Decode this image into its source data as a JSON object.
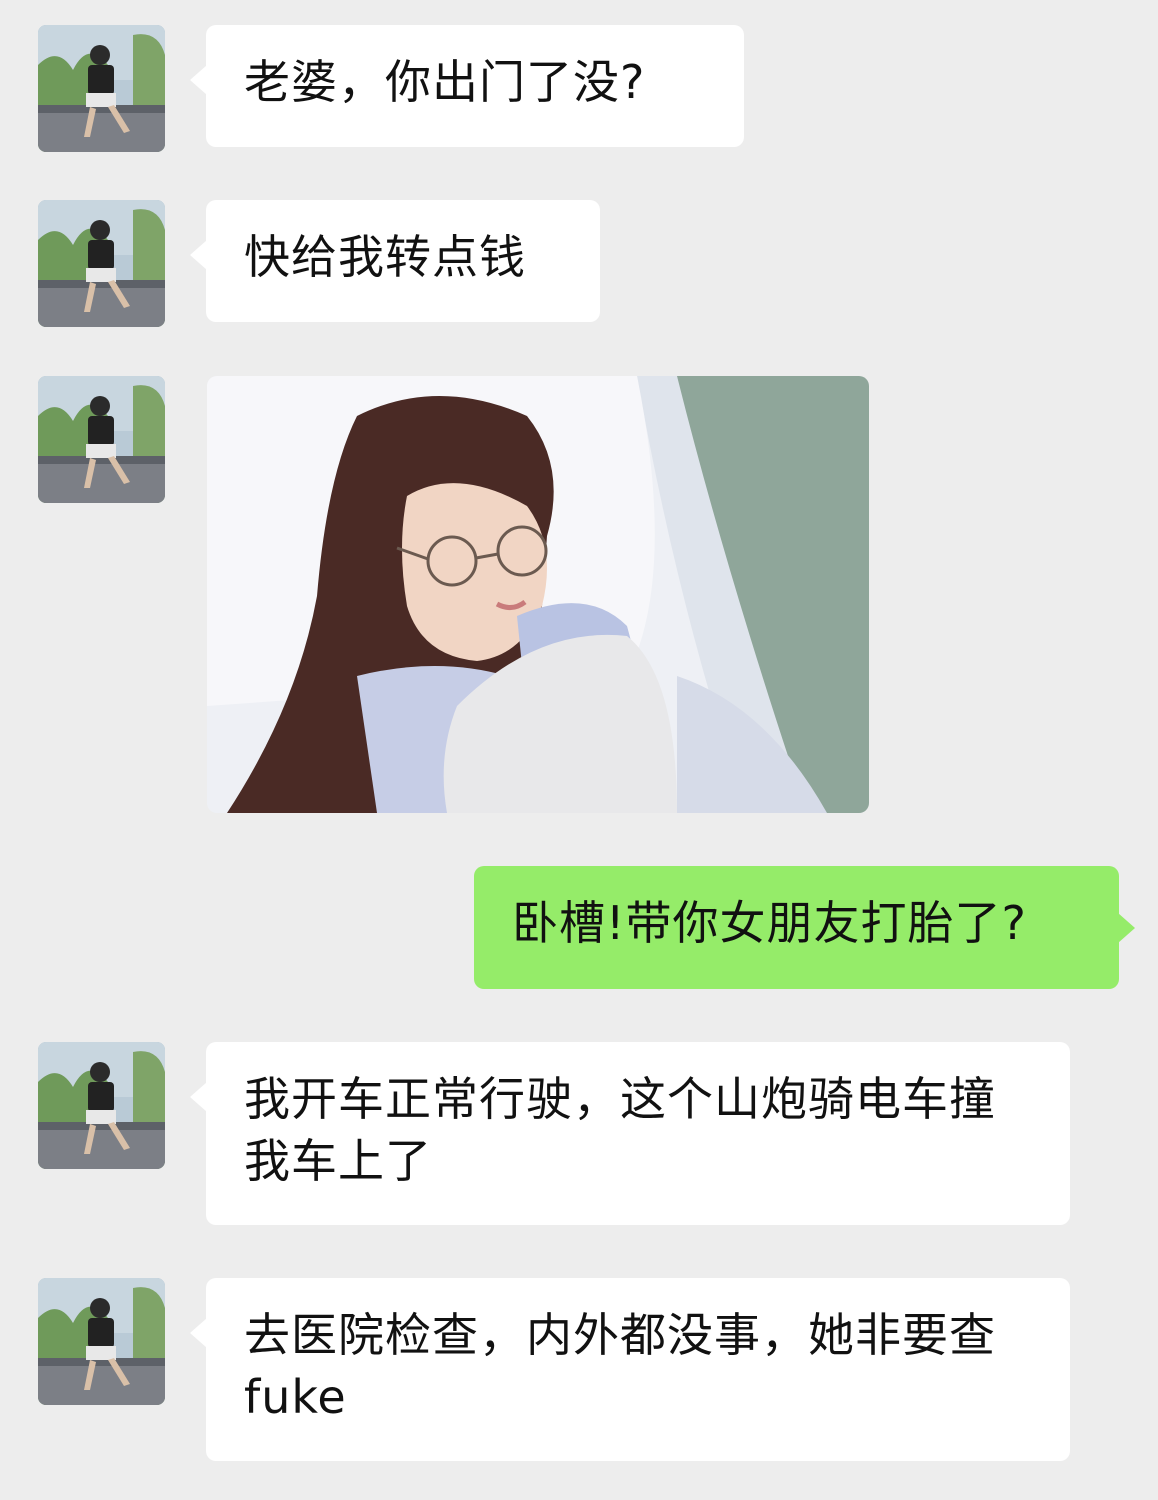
{
  "chat": {
    "messages": [
      {
        "sender": "contact",
        "text": "老婆，你出门了没?"
      },
      {
        "sender": "contact",
        "text": "快给我转点钱"
      },
      {
        "sender": "contact",
        "type": "image",
        "image_description_icon": "photo-woman-lying-in-bed-icon"
      },
      {
        "sender": "self",
        "text": "卧槽!带你女朋友打胎了?"
      },
      {
        "sender": "contact",
        "text": "我开车正常行驶，这个山炮骑电车撞我车上了"
      },
      {
        "sender": "contact",
        "text": "去医院检查，内外都没事，她非要查fuke"
      }
    ]
  },
  "colors": {
    "background": "#ededed",
    "contact_bubble": "#ffffff",
    "self_bubble": "#95ec69",
    "text": "#111111"
  },
  "icons": {
    "contact_avatar": "avatar-photo-man-sitting-icon"
  }
}
